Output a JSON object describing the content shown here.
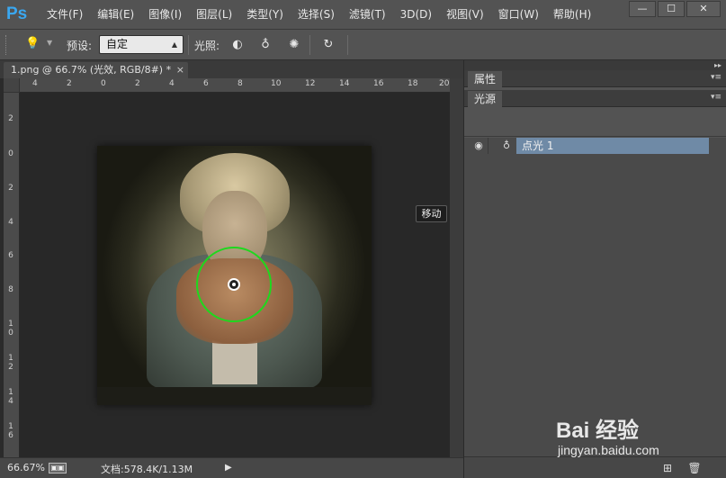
{
  "app": {
    "logo": "Ps"
  },
  "menu": [
    "文件(F)",
    "编辑(E)",
    "图像(I)",
    "图层(L)",
    "类型(Y)",
    "选择(S)",
    "滤镜(T)",
    "3D(D)",
    "视图(V)",
    "窗口(W)",
    "帮助(H)"
  ],
  "window_controls": {
    "minimize": "—",
    "restore": "☐",
    "close": "✕"
  },
  "options": {
    "preset_label": "预设:",
    "preset_value": "自定",
    "light_label": "光照:"
  },
  "document": {
    "tab_title": "1.png @ 66.7% (光效, RGB/8#) *",
    "close_glyph": "×"
  },
  "ruler_h_labels": [
    "4",
    "2",
    "0",
    "2",
    "4",
    "6",
    "8",
    "10",
    "12",
    "14",
    "16",
    "18",
    "20"
  ],
  "ruler_v_labels": [
    "2",
    "0",
    "2",
    "4",
    "6",
    "8",
    "1 0",
    "1 2",
    "1 4",
    "1 6"
  ],
  "tooltip": "移动",
  "status": {
    "zoom": "66.67%",
    "doc_size": "文档:578.4K/1.13M"
  },
  "panels": {
    "properties_tab": "属性",
    "lights_tab": "光源",
    "light_item": "点光 1"
  },
  "watermark": {
    "logo": "Bai 经验",
    "url": "jingyan.baidu.com"
  },
  "colors": {
    "ps_blue": "#3aa7f0",
    "light_ring": "#1ed81e",
    "selection": "#6f8aa6"
  }
}
